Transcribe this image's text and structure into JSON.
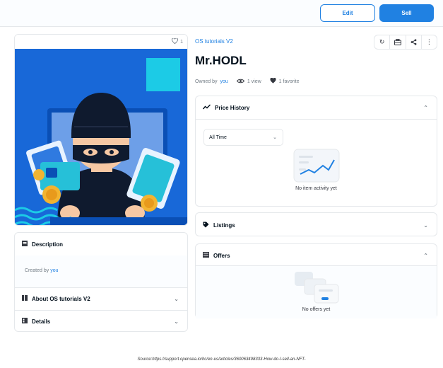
{
  "toolbar": {
    "edit_label": "Edit",
    "sell_label": "Sell"
  },
  "asset": {
    "collection": "OS tutorials V2",
    "name": "Mr.HODL",
    "favorites_count": "1",
    "owned_by_label": "Owned by",
    "owner": "you",
    "views": "1 view",
    "favorites": "1 favorite"
  },
  "description_panel": {
    "title": "Description",
    "created_by_label": "Created by",
    "creator": "you"
  },
  "about_panel": {
    "title": "About OS tutorials V2"
  },
  "details_panel": {
    "title": "Details"
  },
  "price_history": {
    "title": "Price History",
    "filter_value": "All Time",
    "empty_text": "No item activity yet"
  },
  "listings": {
    "title": "Listings"
  },
  "offers": {
    "title": "Offers",
    "empty_text": "No offers yet"
  },
  "source_caption": "Source:https://support.opensea.io/hc/en-us/articles/360063498333-How-do-I-sell-an-NFT-",
  "colors": {
    "accent": "#2081e2",
    "image_bg": "#1868d8"
  }
}
